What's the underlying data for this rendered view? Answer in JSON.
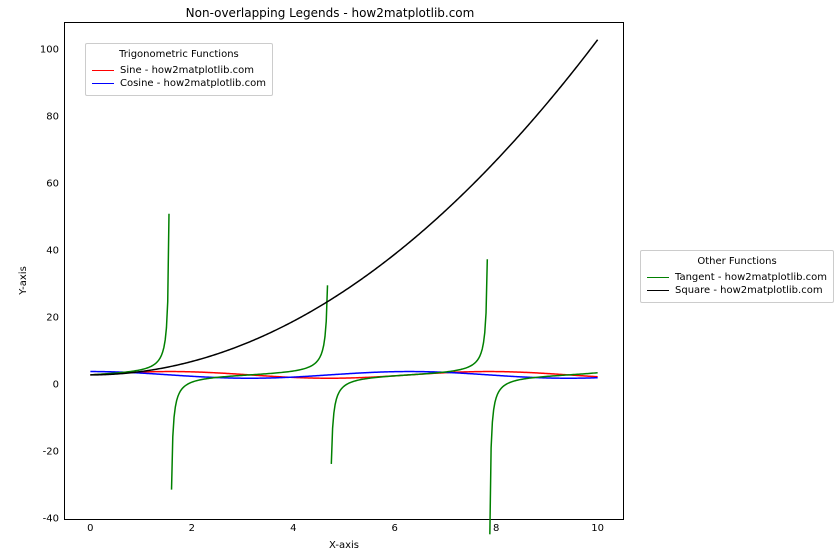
{
  "chart_data": {
    "type": "line",
    "title": "Non-overlapping Legends - how2matplotlib.com",
    "xlabel": "X-axis",
    "ylabel": "Y-axis",
    "xlim": [
      -0.5,
      10.5
    ],
    "ylim": [
      -43,
      105
    ],
    "xticks": [
      0,
      2,
      4,
      6,
      8,
      10
    ],
    "yticks": [
      -40,
      -20,
      0,
      20,
      40,
      60,
      80,
      100
    ],
    "series": [
      {
        "name": "Sine - how2matplotlib.com",
        "color": "#ff0000",
        "fn": "sin"
      },
      {
        "name": "Cosine - how2matplotlib.com",
        "color": "#0000ff",
        "fn": "cos"
      },
      {
        "name": "Tangent - how2matplotlib.com",
        "color": "#008000",
        "fn": "tan"
      },
      {
        "name": "Square - how2matplotlib.com",
        "color": "#000000",
        "fn": "sq"
      }
    ],
    "legends": [
      {
        "title": "Trigonometric Functions",
        "location": "inside-upper-left",
        "series_idx": [
          0,
          1
        ]
      },
      {
        "title": "Other Functions",
        "location": "outside-right-center",
        "series_idx": [
          2,
          3
        ]
      }
    ]
  }
}
